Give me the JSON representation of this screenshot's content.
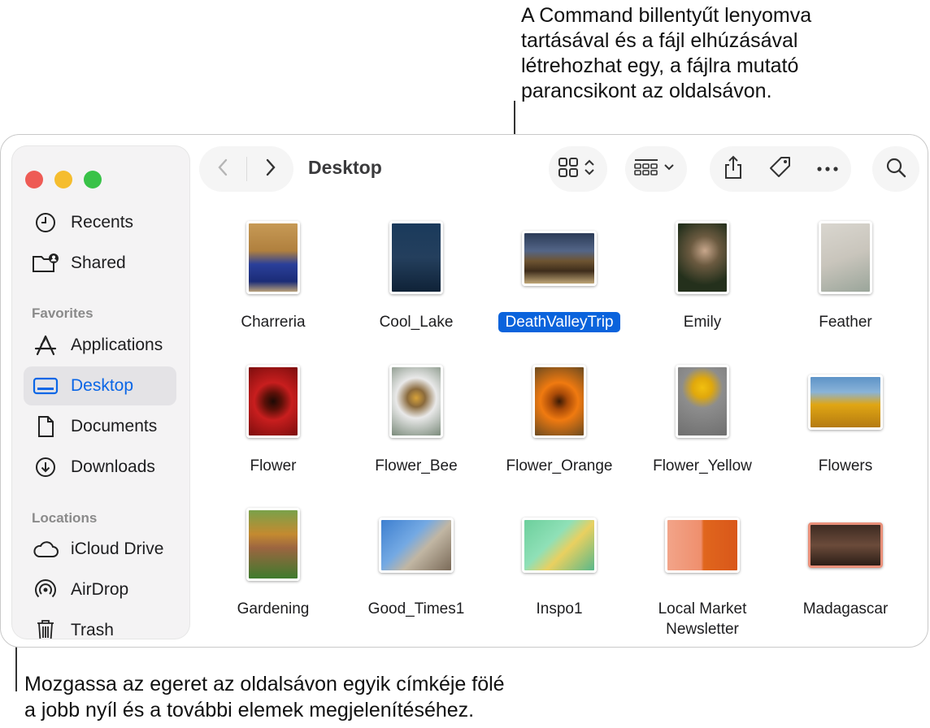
{
  "callouts": {
    "top": [
      "A Command billentyűt lenyomva",
      "tartásával és a fájl elhúzásával",
      "létrehozhat egy, a fájlra mutató",
      "parancsikont az oldalsávon."
    ],
    "bottom": [
      "Mozgassa az egeret az oldalsávon egyik címkéje fölé",
      "a jobb nyíl és a további elemek megjelenítéséhez."
    ]
  },
  "window": {
    "title": "Desktop"
  },
  "sidebar": {
    "top_items": [
      {
        "label": "Recents",
        "icon": "clock-icon"
      },
      {
        "label": "Shared",
        "icon": "shared-folder-icon"
      }
    ],
    "favorites_heading": "Favorites",
    "favorites": [
      {
        "label": "Applications",
        "icon": "applications-icon"
      },
      {
        "label": "Desktop",
        "icon": "desktop-icon",
        "selected": true
      },
      {
        "label": "Documents",
        "icon": "document-icon"
      },
      {
        "label": "Downloads",
        "icon": "download-icon"
      }
    ],
    "locations_heading": "Locations",
    "locations": [
      {
        "label": "iCloud Drive",
        "icon": "cloud-icon"
      },
      {
        "label": "AirDrop",
        "icon": "airdrop-icon"
      },
      {
        "label": "Trash",
        "icon": "trash-icon"
      }
    ]
  },
  "files": [
    {
      "name": "Charreria"
    },
    {
      "name": "Cool_Lake"
    },
    {
      "name": "DeathValleyTrip",
      "selected": true
    },
    {
      "name": "Emily"
    },
    {
      "name": "Feather"
    },
    {
      "name": "Flower"
    },
    {
      "name": "Flower_Bee"
    },
    {
      "name": "Flower_Orange"
    },
    {
      "name": "Flower_Yellow"
    },
    {
      "name": "Flowers"
    },
    {
      "name": "Gardening"
    },
    {
      "name": "Good_Times1"
    },
    {
      "name": "Inspo1"
    },
    {
      "name": "Local Market Newsletter",
      "line1": "Local Market",
      "line2": "Newsletter"
    },
    {
      "name": "Madagascar"
    }
  ],
  "colors": {
    "accent": "#0a63dc",
    "selection_bg": "#e4e3e6"
  }
}
